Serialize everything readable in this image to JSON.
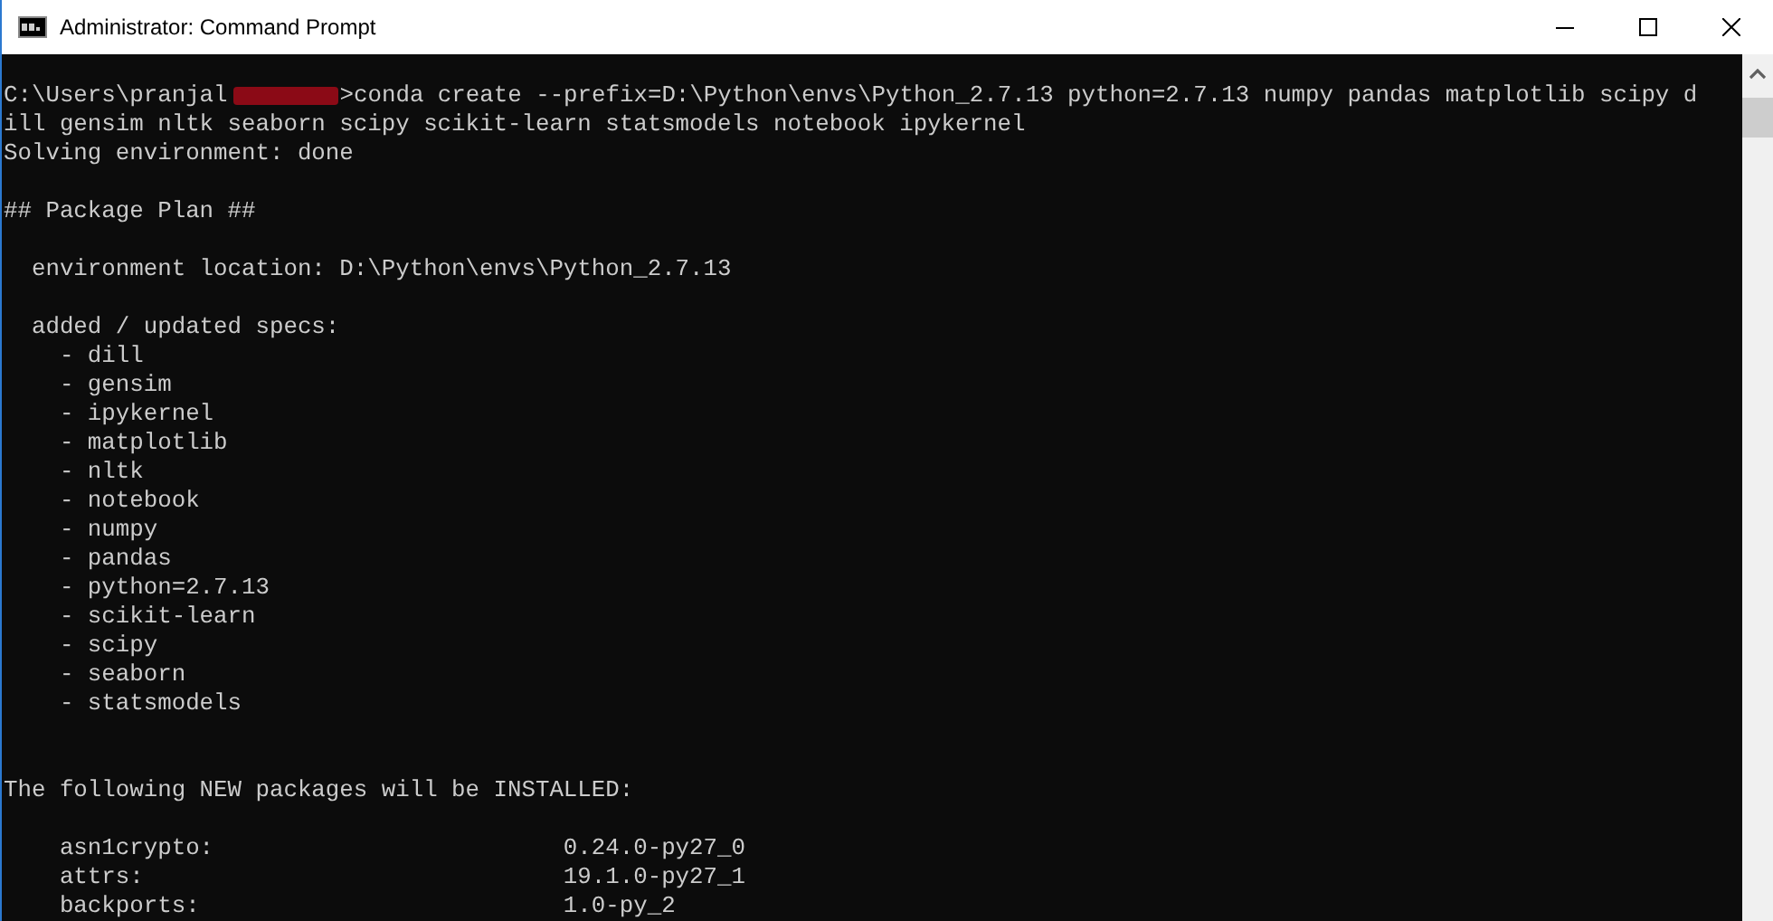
{
  "window": {
    "title": "Administrator: Command Prompt"
  },
  "console": {
    "lines": [
      {
        "kind": "prompt",
        "path": "C:\\Users\\pranjal",
        "redacted": true,
        "command": ">conda create --prefix=D:\\Python\\envs\\Python_2.7.13 python=2.7.13 numpy pandas matplotlib scipy d"
      },
      {
        "kind": "text",
        "text": "ill gensim nltk seaborn scipy scikit-learn statsmodels notebook ipykernel"
      },
      {
        "kind": "text",
        "text": "Solving environment: done"
      },
      {
        "kind": "blank"
      },
      {
        "kind": "text",
        "text": "## Package Plan ##"
      },
      {
        "kind": "blank"
      },
      {
        "kind": "text",
        "text": "  environment location: D:\\Python\\envs\\Python_2.7.13"
      },
      {
        "kind": "blank"
      },
      {
        "kind": "text",
        "text": "  added / updated specs:"
      },
      {
        "kind": "text",
        "text": "    - dill"
      },
      {
        "kind": "text",
        "text": "    - gensim"
      },
      {
        "kind": "text",
        "text": "    - ipykernel"
      },
      {
        "kind": "text",
        "text": "    - matplotlib"
      },
      {
        "kind": "text",
        "text": "    - nltk"
      },
      {
        "kind": "text",
        "text": "    - notebook"
      },
      {
        "kind": "text",
        "text": "    - numpy"
      },
      {
        "kind": "text",
        "text": "    - pandas"
      },
      {
        "kind": "text",
        "text": "    - python=2.7.13"
      },
      {
        "kind": "text",
        "text": "    - scikit-learn"
      },
      {
        "kind": "text",
        "text": "    - scipy"
      },
      {
        "kind": "text",
        "text": "    - seaborn"
      },
      {
        "kind": "text",
        "text": "    - statsmodels"
      },
      {
        "kind": "blank"
      },
      {
        "kind": "blank"
      },
      {
        "kind": "text",
        "text": "The following NEW packages will be INSTALLED:"
      },
      {
        "kind": "blank"
      },
      {
        "kind": "text",
        "text": "    asn1crypto:                         0.24.0-py27_0"
      },
      {
        "kind": "text",
        "text": "    attrs:                              19.1.0-py27_1"
      },
      {
        "kind": "text",
        "text": "    backports:                          1.0-py_2"
      }
    ]
  }
}
